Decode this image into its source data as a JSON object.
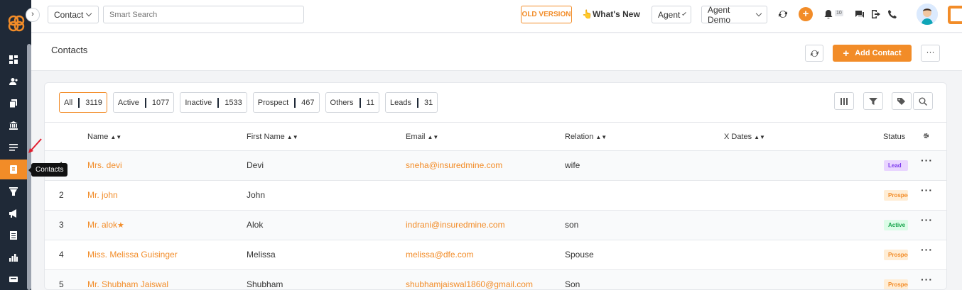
{
  "topbar": {
    "module_select": "Contact",
    "search_placeholder": "Smart Search",
    "old_version": "OLD VERSION",
    "whats_new_emoji": "👆",
    "whats_new": "What's New",
    "role_select": "Agent",
    "user_select": "Agent Demo",
    "notification_count": "10"
  },
  "tooltip": "Contacts",
  "header": {
    "title": "Contacts",
    "add_button": "Add Contact",
    "more": "···"
  },
  "filters": [
    {
      "label": "All",
      "count": "3119"
    },
    {
      "label": "Active",
      "count": "1077"
    },
    {
      "label": "Inactive",
      "count": "1533"
    },
    {
      "label": "Prospect",
      "count": "467"
    },
    {
      "label": "Others",
      "count": "11"
    },
    {
      "label": "Leads",
      "count": "31"
    }
  ],
  "columns": {
    "name": "Name",
    "first_name": "First Name",
    "email": "Email",
    "relation": "Relation",
    "x_dates": "X Dates",
    "status": "Status"
  },
  "rows": [
    {
      "index": "1",
      "name": "Mrs. devi",
      "first_name": "Devi",
      "email": "sneha@insuredmine.com",
      "relation": "wife",
      "status": "Lead"
    },
    {
      "index": "2",
      "name": "Mr. john",
      "first_name": "John",
      "email": "",
      "relation": "",
      "status": "Prospect"
    },
    {
      "index": "3",
      "name": "Mr. alok",
      "first_name": "Alok",
      "email": "indrani@insuredmine.com",
      "relation": "son",
      "status": "Active"
    },
    {
      "index": "4",
      "name": "Miss. Melissa Guisinger",
      "first_name": "Melissa",
      "email": "melissa@dfe.com",
      "relation": "Spouse",
      "status": "Prospect"
    },
    {
      "index": "5",
      "name": "Mr. Shubham Jaiswal",
      "first_name": "Shubham",
      "email": "shubhamjaiswal1860@gmail.com",
      "relation": "Son",
      "status": "Prospect"
    }
  ],
  "colors": {
    "accent": "#f28c28",
    "sidebar": "#1f2937"
  }
}
